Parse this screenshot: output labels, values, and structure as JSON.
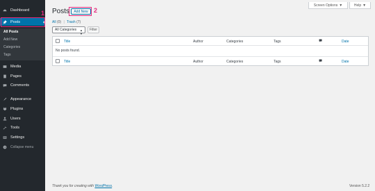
{
  "sidebar": {
    "items": [
      {
        "label": "Dashboard",
        "icon": "dashboard-icon"
      },
      {
        "label": "Posts",
        "icon": "pin-icon"
      },
      {
        "label": "Media",
        "icon": "media-icon"
      },
      {
        "label": "Pages",
        "icon": "pages-icon"
      },
      {
        "label": "Comments",
        "icon": "comments-icon"
      },
      {
        "label": "Appearance",
        "icon": "brush-icon"
      },
      {
        "label": "Plugins",
        "icon": "plugin-icon"
      },
      {
        "label": "Users",
        "icon": "users-icon"
      },
      {
        "label": "Tools",
        "icon": "wrench-icon"
      },
      {
        "label": "Settings",
        "icon": "settings-icon"
      },
      {
        "label": "Collapse menu",
        "icon": "collapse-icon"
      }
    ],
    "submenu": [
      "All Posts",
      "Add New",
      "Categories",
      "Tags"
    ]
  },
  "annotations": {
    "step1": "1",
    "step2": "2",
    "color": "#e6287d"
  },
  "top_buttons": {
    "screen_options": "Screen Options",
    "help": "Help"
  },
  "main": {
    "title": "Posts",
    "add_new": "Add New",
    "filters": {
      "all": "All",
      "all_count": "(0)",
      "trash": "Trash",
      "trash_count": "(7)",
      "separator": "|"
    },
    "category_select": "All Categories",
    "filter_button": "Filter",
    "table": {
      "columns": [
        "Title",
        "Author",
        "Categories",
        "Tags",
        "Date"
      ],
      "empty_message": "No posts found."
    }
  },
  "footer": {
    "thanks_prefix": "Thank you for creating with ",
    "thanks_link": "WordPress",
    "thanks_suffix": ".",
    "version": "Version 5.2.2"
  },
  "colors": {
    "sidebar": "#23282d",
    "active": "#0073aa",
    "link": "#0073aa",
    "background": "#f1f1f1"
  }
}
